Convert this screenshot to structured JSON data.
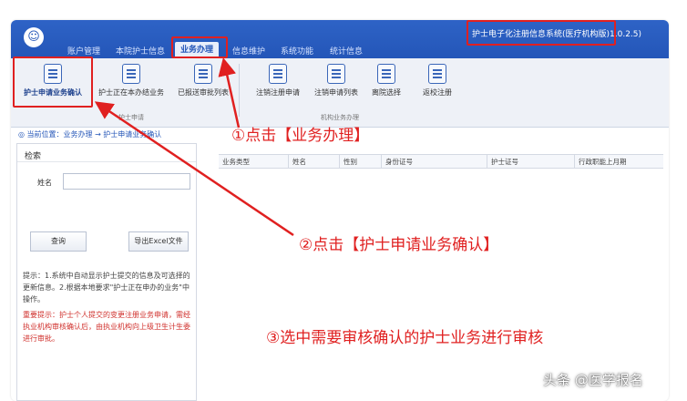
{
  "menu": {
    "items": [
      "账户管理",
      "本院护士信息",
      "业务办理",
      "信息维护",
      "系统功能",
      "统计信息"
    ],
    "active_index": 2
  },
  "system_title": "护士电子化注册信息系统(医疗机构版)1.0.2.5)",
  "ribbon": {
    "buttons": [
      {
        "label": "护士申请业务确认",
        "icon": "document-icon"
      },
      {
        "label": "护士正在本办结业务",
        "icon": "list-icon"
      },
      {
        "label": "已报送审批列表",
        "icon": "file-check-icon"
      },
      {
        "label": "注销注册申请",
        "icon": "clock-doc-icon"
      },
      {
        "label": "注销申请列表",
        "icon": "list-icon"
      },
      {
        "label": "离院选择",
        "icon": "clip-icon"
      },
      {
        "label": "返校注册",
        "icon": "register-icon"
      }
    ],
    "groups": [
      "护士申请",
      "机构业务办理"
    ]
  },
  "breadcrumb": "◎ 当前位置：业务办理 → 护士申请业务确认",
  "left_panel": {
    "header": "检索",
    "field_label": "姓名",
    "field_value": "",
    "search_button": "查询",
    "export_button": "导出Excel文件",
    "tips": "提示：1.系统中自动显示护士提交的信息及可选择的更新信息。2.根据本地要求\"护士正在申办的业务\"中操作。",
    "warning": "重要提示：护士个人提交的变更注册业务申请，需经执业机构审核确认后，由执业机构向上级卫生计生委进行审批。"
  },
  "table": {
    "columns": [
      "业务类型",
      "姓名",
      "性别",
      "身份证号",
      "护士证号",
      "行政职能上月期"
    ]
  },
  "annotations": {
    "step1": "①点击【业务办理】",
    "step2": "②点击【护士申请业务确认】",
    "step3": "③选中需要审核确认的护士业务进行审核"
  },
  "watermark": "头条 @医学报名",
  "colors": {
    "titlebar": "#2456b8",
    "annotation_red": "#e02020"
  }
}
